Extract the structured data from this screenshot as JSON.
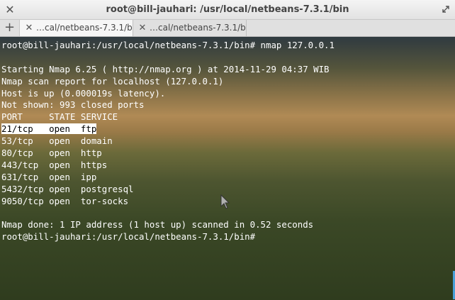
{
  "window": {
    "title": "root@bill-jauhari: /usr/local/netbeans-7.3.1/bin",
    "close_glyph": "✕"
  },
  "tabs": {
    "new_tab_glyph": "+",
    "items": [
      {
        "label": "…cal/netbeans-7.3.1/bin",
        "close_glyph": "✕",
        "active": true
      },
      {
        "label": "…cal/netbeans-7.3.1/bin",
        "close_glyph": "✕",
        "active": false
      }
    ]
  },
  "terminal": {
    "lines": [
      "root@bill-jauhari:/usr/local/netbeans-7.3.1/bin# nmap 127.0.0.1",
      "",
      "Starting Nmap 6.25 ( http://nmap.org ) at 2014-11-29 04:37 WIB",
      "Nmap scan report for localhost (127.0.0.1)",
      "Host is up (0.000019s latency).",
      "Not shown: 993 closed ports",
      "PORT     STATE SERVICE",
      "21/tcp   open  ftp",
      "53/tcp   open  domain",
      "80/tcp   open  http",
      "443/tcp  open  https",
      "631/tcp  open  ipp",
      "5432/tcp open  postgresql",
      "9050/tcp open  tor-socks",
      "",
      "Nmap done: 1 IP address (1 host up) scanned in 0.52 seconds",
      "root@bill-jauhari:/usr/local/netbeans-7.3.1/bin#"
    ]
  },
  "colors": {
    "terminal_text": "#ffffff",
    "highlight_bg": "#ffffff",
    "highlight_fg": "#000000",
    "scrollbar": "#4aa0d8"
  }
}
